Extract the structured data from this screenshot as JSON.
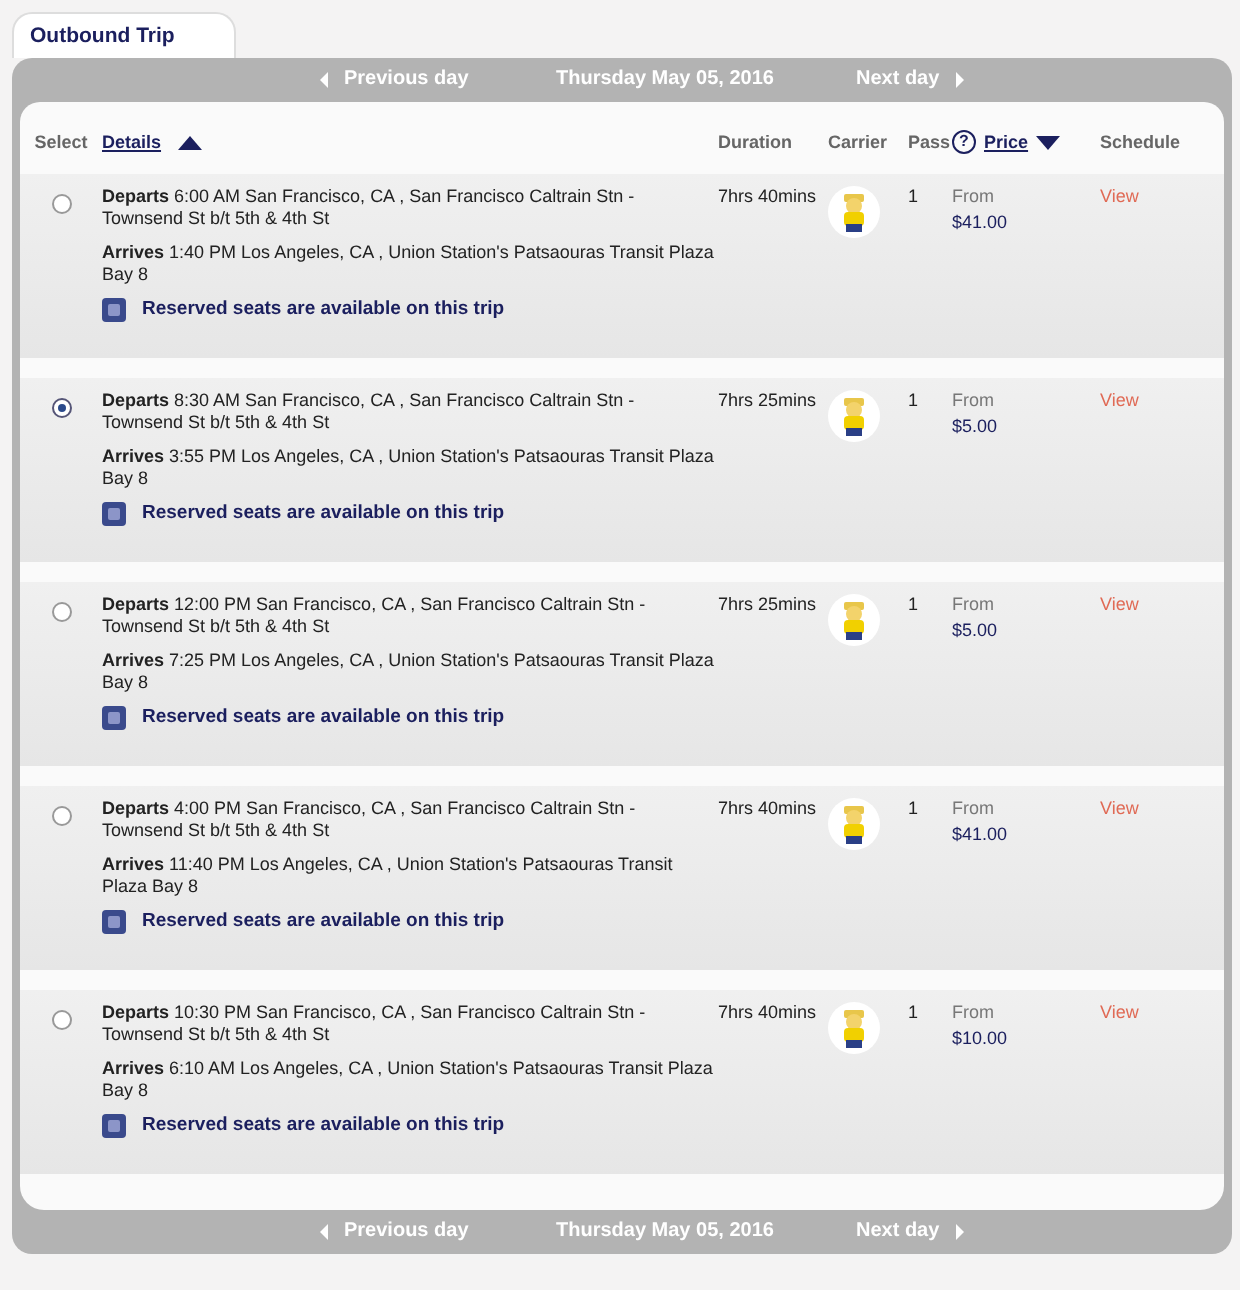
{
  "tab": {
    "label": "Outbound Trip"
  },
  "nav_top": {
    "previous": "Previous day",
    "date": "Thursday May 05, 2016",
    "next": "Next day"
  },
  "columns": {
    "select": "Select",
    "details": "Details",
    "duration": "Duration",
    "carrier": "Carrier",
    "pass": "Pass",
    "help": "?",
    "price": "Price",
    "schedule": "Schedule"
  },
  "trips": [
    {
      "selected": false,
      "departs": "**Departs** 6:00 AM San Francisco, CA , San Francisco Caltrain Stn - Townsend St b/t 5th & 4th St",
      "arrives": "**Arrives** 1:40 PM Los Angeles, CA , Union Station's Patsaouras Transit Plaza Bay 8",
      "reserved": "Reserved seats are available on this trip",
      "duration": "7hrs 40mins",
      "pass": "1",
      "price_label": "From",
      "price": "$41.00",
      "schedule": "View"
    },
    {
      "selected": true,
      "departs": "**Departs** 8:30 AM San Francisco, CA , San Francisco Caltrain Stn - Townsend St b/t 5th & 4th St",
      "arrives": "**Arrives** 3:55 PM Los Angeles, CA , Union Station's Patsaouras Transit Plaza Bay 8",
      "reserved": "Reserved seats are available on this trip",
      "duration": "7hrs 25mins",
      "pass": "1",
      "price_label": "From",
      "price": "$5.00",
      "schedule": "View"
    },
    {
      "selected": false,
      "departs": "**Departs** 12:00 PM San Francisco, CA , San Francisco Caltrain Stn - Townsend St b/t 5th & 4th St",
      "arrives": "**Arrives** 7:25 PM Los Angeles, CA , Union Station's Patsaouras Transit Plaza Bay 8",
      "reserved": "Reserved seats are available on this trip",
      "duration": "7hrs 25mins",
      "pass": "1",
      "price_label": "From",
      "price": "$5.00",
      "schedule": "View"
    },
    {
      "selected": false,
      "departs": "**Departs** 4:00 PM San Francisco, CA , San Francisco Caltrain Stn - Townsend St b/t 5th & 4th St",
      "arrives": "**Arrives** 11:40 PM Los Angeles, CA , Union Station's Patsaouras Transit Plaza Bay 8",
      "reserved": "Reserved seats are available on this trip",
      "duration": "7hrs 40mins",
      "pass": "1",
      "price_label": "From",
      "price": "$41.00",
      "schedule": "View"
    },
    {
      "selected": false,
      "departs": "**Departs** 10:30 PM San Francisco, CA , San Francisco Caltrain Stn - Townsend St b/t 5th & 4th St",
      "arrives": "**Arrives** 6:10 AM Los Angeles, CA , Union Station's Patsaouras Transit Plaza Bay 8",
      "reserved": "Reserved seats are available on this trip",
      "duration": "7hrs 40mins",
      "pass": "1",
      "price_label": "From",
      "price": "$10.00",
      "schedule": "View"
    }
  ],
  "nav_bottom": {
    "previous": "Previous day",
    "date": "Thursday May 05, 2016",
    "next": "Next day"
  }
}
